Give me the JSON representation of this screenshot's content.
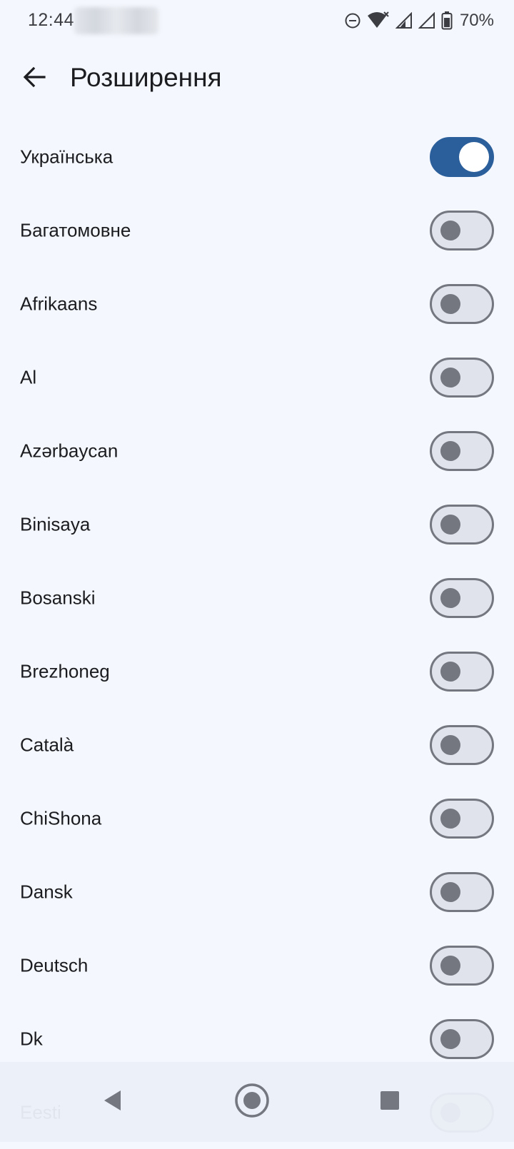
{
  "status": {
    "time": "12:44",
    "battery": "70%",
    "icons": [
      "do-not-disturb-icon",
      "wifi-icon",
      "signal-icon",
      "signal-icon",
      "battery-icon"
    ]
  },
  "header": {
    "title": "Розширення",
    "back_icon": "arrow-left-icon"
  },
  "extensions": [
    {
      "label": "Українська",
      "enabled": true
    },
    {
      "label": "Багатомовне",
      "enabled": false
    },
    {
      "label": "Afrikaans",
      "enabled": false
    },
    {
      "label": "Al",
      "enabled": false
    },
    {
      "label": "Azərbaycan",
      "enabled": false
    },
    {
      "label": "Binisaya",
      "enabled": false
    },
    {
      "label": "Bosanski",
      "enabled": false
    },
    {
      "label": "Brezhoneg",
      "enabled": false
    },
    {
      "label": "Català",
      "enabled": false
    },
    {
      "label": "ChiShona",
      "enabled": false
    },
    {
      "label": "Dansk",
      "enabled": false
    },
    {
      "label": "Deutsch",
      "enabled": false
    },
    {
      "label": "Dk",
      "enabled": false
    },
    {
      "label": "Eesti",
      "enabled": false
    }
  ],
  "navigation": {
    "back": "nav-back-icon",
    "home": "nav-home-icon",
    "recents": "nav-recents-icon"
  },
  "colors": {
    "accent": "#2b5f9b",
    "background": "#f4f7fd",
    "toggle_off": "#74777f"
  }
}
